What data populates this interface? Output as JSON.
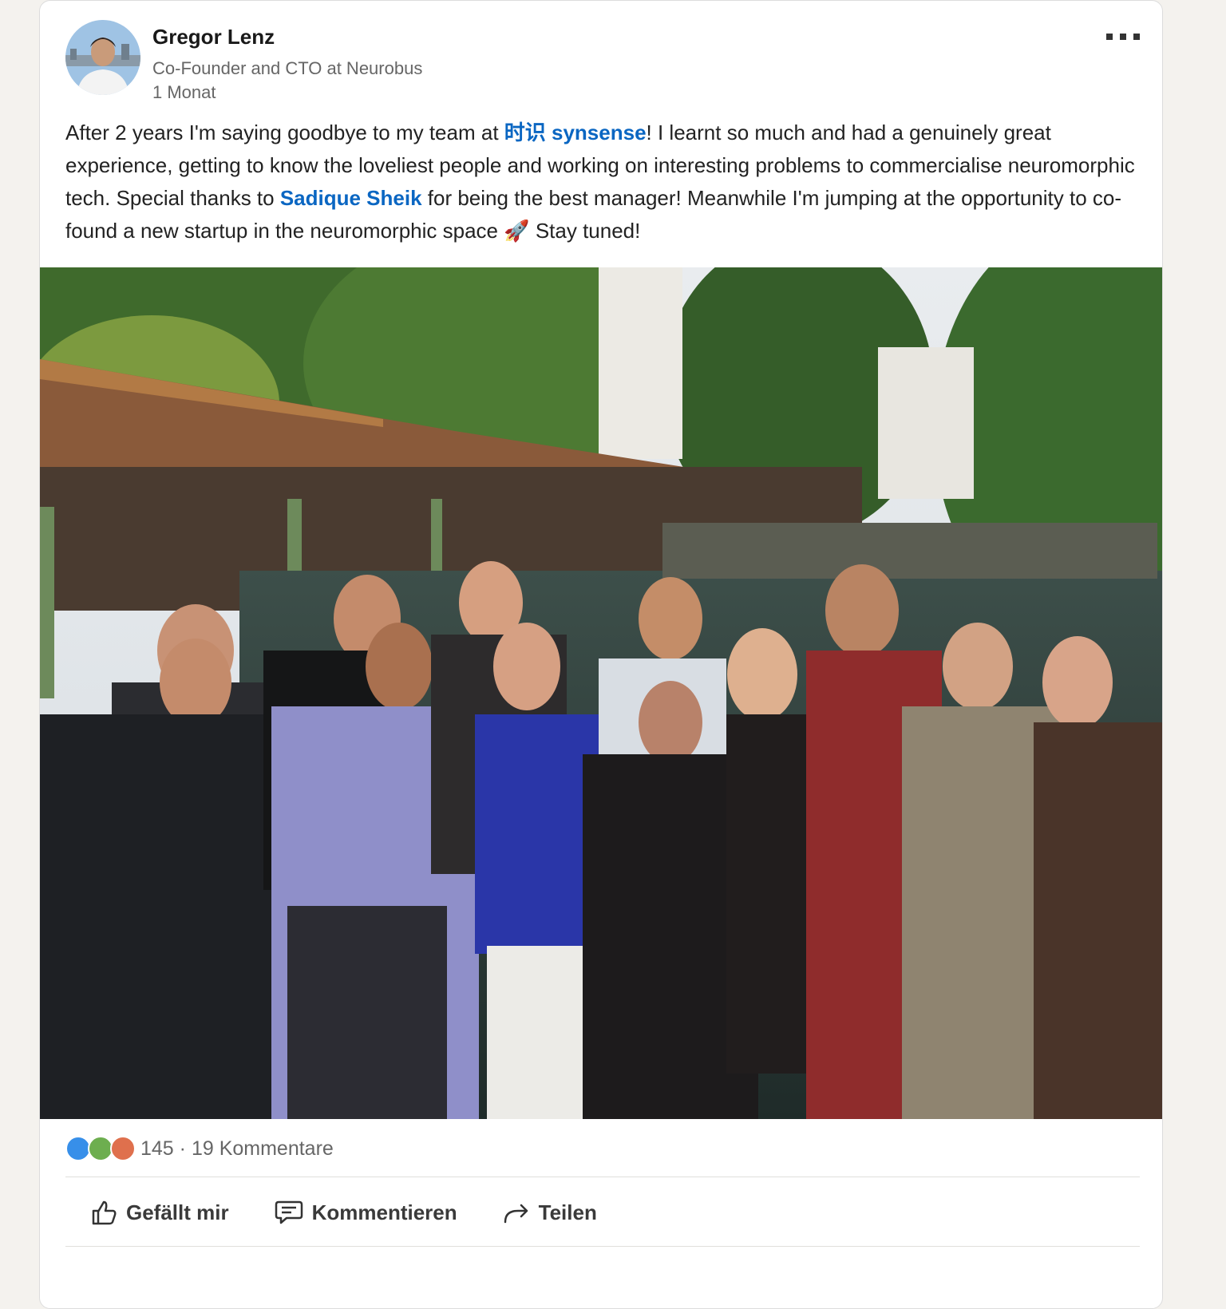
{
  "author": {
    "name": "Gregor Lenz",
    "headline": "Co-Founder and CTO at Neurobus",
    "time": "1 Monat"
  },
  "post": {
    "seg1": "After 2 years I'm saying goodbye to my team at ",
    "link1": "时识 synsense",
    "seg2": "! I learnt so much and had a genuinely great experience, getting to know the loveliest people and working on interesting problems to commercialise neuromorphic tech. Special thanks to ",
    "link2": "Sadique Sheik",
    "seg3": " for being the best manager! Meanwhile I'm jumping at the opportunity to co-found a new startup in the neuromorphic space ",
    "emoji": "🚀",
    "seg4": " Stay tuned!"
  },
  "stats": {
    "reactions": "145",
    "separator": " · ",
    "comments": "19 Kommentare"
  },
  "actions": {
    "like": "Gefällt mir",
    "comment": "Kommentieren",
    "share": "Teilen"
  },
  "more_label": "▪▪▪",
  "icons": [
    "like-reaction-icon",
    "celebrate-reaction-icon",
    "love-reaction-icon",
    "thumbs-up-icon",
    "comment-icon",
    "share-arrow-icon",
    "more-options-icon"
  ],
  "colors": {
    "link": "#0a66c2",
    "like": "#378fe9",
    "celebrate": "#6dae4f",
    "love": "#df704d"
  }
}
